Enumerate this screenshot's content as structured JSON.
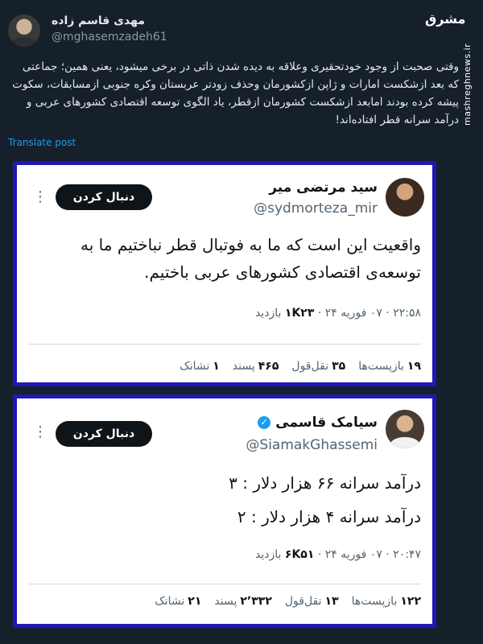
{
  "post": {
    "author_name": "مهدی قاسم زاده",
    "author_handle": "@mghasemzadeh61",
    "text": "وقتی صحبت از وجود خودتحقیری وعلاقه به دیده شدن ذاتی در برخی میشود، یعنی همین؛ جماعتی که بعد ازشکست امارات و ژاپن ازکشورمان وحذف زودتر عربستان وکره جنوبی ازمسابقات، سکوت پیشه کرده بودند امابعد ازشکست کشورمان ازقطر، یاد الگوی توسعه اقتصادی کشورهای عربی و درآمد سرانه قطر افتاده‌اند!",
    "translate": "Translate post"
  },
  "watermark": {
    "logo": "مشرق",
    "site": "mashreghnews.ir"
  },
  "embeds": [
    {
      "name": "سید مرتضی میر",
      "handle": "@sydmorteza_mir",
      "verified": false,
      "follow_label": "دنبال کردن",
      "body_lines": [
        "واقعیت این است که ما به فوتبال قطر نباختیم ما به",
        "توسعه‌ی اقتصادی کشورهای عربی باختیم."
      ],
      "meta_time": "۲۲:۵۸ · ۰۷ فوریه ۲۴ · ",
      "meta_views": "۱K۲۳",
      "meta_views_label": " بازدید",
      "stats": [
        {
          "value": "۱۹",
          "label": "بازپست‌ها"
        },
        {
          "value": "۳۵",
          "label": "نقل‌قول"
        },
        {
          "value": "۴۶۵",
          "label": "پسند"
        },
        {
          "value": "۱",
          "label": "نشانک"
        }
      ]
    },
    {
      "name": "سیامک قاسمی",
      "handle": "@SiamakGhassemi",
      "verified": true,
      "follow_label": "دنبال کردن",
      "body_lines": [
        "درآمد سرانه ۶۶ هزار دلار : ۳",
        "درآمد سرانه ۴ هزار دلار : ۲"
      ],
      "meta_time": "۲۰:۴۷ · ۰۷ فوریه ۲۴ · ",
      "meta_views": "۶K۵۱",
      "meta_views_label": " بازدید",
      "stats": [
        {
          "value": "۱۲۲",
          "label": "بازپست‌ها"
        },
        {
          "value": "۱۳",
          "label": "نقل‌قول"
        },
        {
          "value": "۲٬۳۳۲",
          "label": "پسند"
        },
        {
          "value": "۲۱",
          "label": "نشانک"
        }
      ]
    }
  ],
  "colors": {
    "background": "#15202b",
    "embed_border": "#1f17b8",
    "link": "#1d9bf0"
  }
}
